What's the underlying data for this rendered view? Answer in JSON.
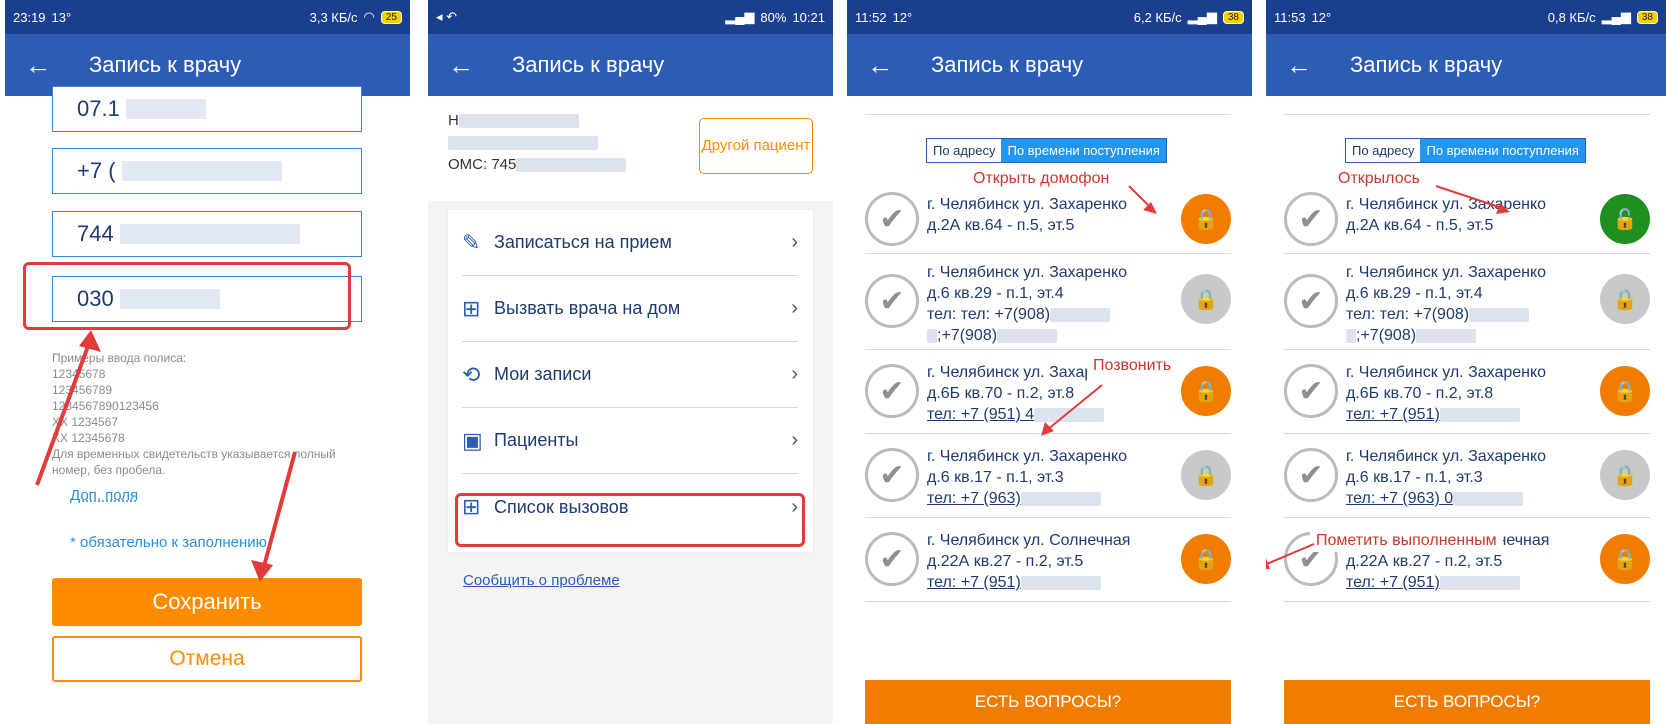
{
  "panel1": {
    "status_time": "23:19",
    "status_temp": "13°",
    "status_speed": "3,3 КБ/с",
    "battery": "25",
    "title": "Запись к врачу",
    "fields": [
      "07.1",
      "+7 (",
      "744",
      "030"
    ],
    "hint": "Примеры ввода полиса:\n12345678\n123456789\n1234567890123456\nXX 1234567\nXX 12345678\nДля временных свидетельств указывается полный номер, без пробела.",
    "extra_fields_link": "Доп. поля",
    "required_note": "* обязательно к заполнению",
    "save_label": "Сохранить",
    "cancel_label": "Отмена"
  },
  "panel2": {
    "status_battery_pct": "80%",
    "status_time": "10:21",
    "title": "Запись к врачу",
    "patient_initial": "Н",
    "oms_prefix": "ОМС: 745",
    "other_patient_label": "Другой пациент",
    "menu": [
      {
        "label": "Записаться на прием",
        "icon": "pencil-icon"
      },
      {
        "label": "Вызвать врача на дом",
        "icon": "medkit-icon"
      },
      {
        "label": "Мои записи",
        "icon": "history-icon"
      },
      {
        "label": "Пациенты",
        "icon": "person-card-icon"
      },
      {
        "label": "Список вызовов",
        "icon": "medkit-icon"
      }
    ],
    "report_problem": "Сообщить о проблеме"
  },
  "panel3": {
    "status_time": "11:52",
    "status_temp": "12°",
    "status_speed": "6,2 КБ/с",
    "battery": "38",
    "title": "Запись к врачу",
    "seg_address": "По адресу",
    "seg_time": "По времени поступления",
    "callout_open_intercom": "Открыть домофон",
    "callout_call": "Позвонить",
    "questions_button": "ЕСТЬ ВОПРОСЫ?",
    "rows": [
      {
        "line1": "г. Челябинск ул. Захаренко",
        "line2": "д.2А кв.64 - п.5, эт.5",
        "line3": "",
        "line4": "",
        "lock": "orange"
      },
      {
        "line1": "г. Челябинск ул. Захаренко",
        "line2": "д.6 кв.29 - п.1, эт.4",
        "line3": "тел: тел: +7(908)",
        "line4": ";+7(908)",
        "lock": "gray"
      },
      {
        "line1": "г. Челябинск ул. Захаренко",
        "line2": "д.6Б кв.70 - п.2, эт.8",
        "line3": "тел: +7 (951) 4",
        "line4": "",
        "lock": "orange"
      },
      {
        "line1": "г. Челябинск ул. Захаренко",
        "line2": "д.6 кв.17 - п.1, эт.3",
        "line3": "тел: +7 (963)",
        "line4": "",
        "lock": "gray"
      },
      {
        "line1": "г. Челябинск ул. Солнечная",
        "line2": "д.22А кв.27 - п.2, эт.5",
        "line3": "тел: +7 (951)",
        "line4": "",
        "lock": "orange"
      }
    ]
  },
  "panel4": {
    "status_time": "11:53",
    "status_temp": "12°",
    "status_speed": "0,8 КБ/с",
    "battery": "38",
    "title": "Запись к врачу",
    "seg_address": "По адресу",
    "seg_time": "По времени поступления",
    "callout_opened": "Открылось",
    "callout_mark_done": "Пометить выполненным",
    "questions_button": "ЕСТЬ ВОПРОСЫ?",
    "rows": [
      {
        "line1": "г. Челябинск ул. Захаренко",
        "line2": "д.2А кв.64 - п.5, эт.5",
        "line3": "",
        "line4": "",
        "lock": "green"
      },
      {
        "line1": "г. Челябинск ул. Захаренко",
        "line2": "д.6 кв.29 - п.1, эт.4",
        "line3": "тел: тел: +7(908)",
        "line4": ";+7(908)",
        "lock": "gray"
      },
      {
        "line1": "г. Челябинск ул. Захаренко",
        "line2": "д.6Б кв.70 - п.2, эт.8",
        "line3": "тел: +7 (951)",
        "line4": "",
        "lock": "orange"
      },
      {
        "line1": "г. Челябинск ул. Захаренко",
        "line2": "д.6 кв.17 - п.1, эт.3",
        "line3": "тел: +7 (963) 0",
        "line4": "",
        "lock": "gray"
      },
      {
        "line1": "г. Челябинск ул. Солнечная",
        "line2": "д.22А кв.27 - п.2, эт.5",
        "line3": "тел: +7 (951)",
        "line4": "",
        "lock": "orange"
      }
    ]
  },
  "colors": {
    "appbar": "#2c5cb3",
    "statusbar": "#1b3f8f",
    "accent_orange": "#ff8c00",
    "annotation_red": "#e23b3b",
    "lock_green": "#1f8f1f"
  }
}
